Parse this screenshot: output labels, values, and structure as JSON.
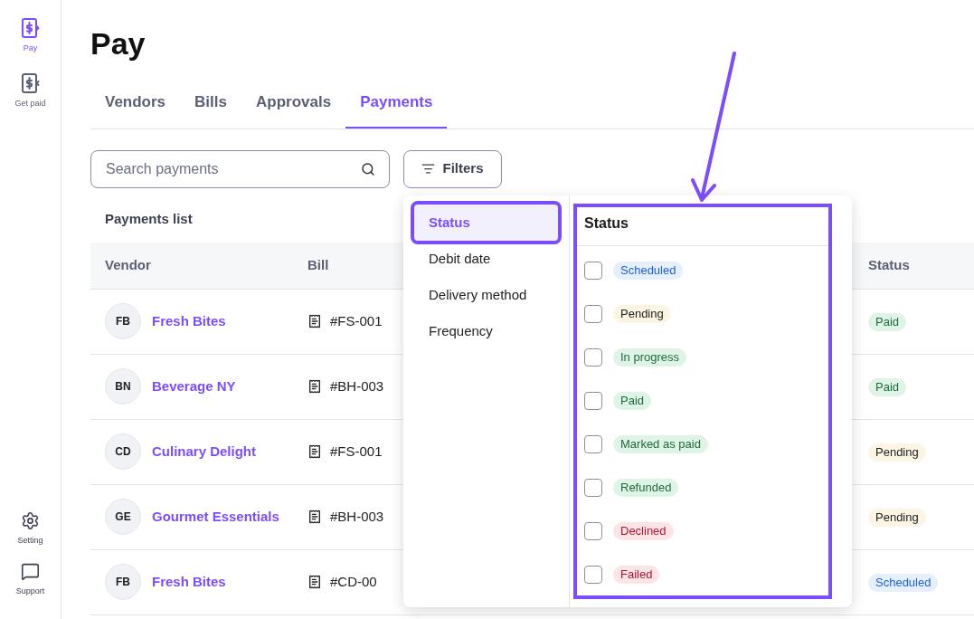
{
  "sidebar": {
    "items": [
      {
        "label": "Pay",
        "selected": true,
        "kind": "pay"
      },
      {
        "label": "Get paid",
        "selected": false,
        "kind": "getpaid"
      }
    ],
    "bottom_items": [
      {
        "label": "Setting",
        "kind": "setting"
      },
      {
        "label": "Support",
        "kind": "support"
      }
    ]
  },
  "page_title": "Pay",
  "tabs": [
    {
      "label": "Vendors",
      "selected": false
    },
    {
      "label": "Bills",
      "selected": false
    },
    {
      "label": "Approvals",
      "selected": false
    },
    {
      "label": "Payments",
      "selected": true
    }
  ],
  "search": {
    "placeholder": "Search payments"
  },
  "filters_button": "Filters",
  "list_title": "Payments list",
  "table": {
    "columns": [
      "Vendor",
      "Bill",
      "Status"
    ],
    "rows": [
      {
        "initials": "FB",
        "vendor": "Fresh Bites",
        "bill": "#FS-001",
        "status": "Paid",
        "kind": "success"
      },
      {
        "initials": "BN",
        "vendor": "Beverage NY",
        "bill": "#BH-003",
        "status": "Paid",
        "kind": "success"
      },
      {
        "initials": "CD",
        "vendor": "Culinary Delight",
        "bill": "#FS-001",
        "status": "Pending",
        "kind": "warning"
      },
      {
        "initials": "GE",
        "vendor": "Gourmet Essentials",
        "bill": "#BH-003",
        "status": "Pending",
        "kind": "warning"
      },
      {
        "initials": "FB",
        "vendor": "Fresh Bites",
        "bill": "#CD-00",
        "status": "Scheduled",
        "kind": "info"
      }
    ]
  },
  "filter_popup": {
    "menu": [
      {
        "label": "Status",
        "selected": true
      },
      {
        "label": "Debit date",
        "selected": false
      },
      {
        "label": "Delivery method",
        "selected": false
      },
      {
        "label": "Frequency",
        "selected": false
      }
    ],
    "panel_title": "Status",
    "options": [
      {
        "label": "Scheduled",
        "kind": "info",
        "checked": false
      },
      {
        "label": "Pending",
        "kind": "warning",
        "checked": false
      },
      {
        "label": "In progress",
        "kind": "success",
        "checked": false
      },
      {
        "label": "Paid",
        "kind": "success",
        "checked": false
      },
      {
        "label": "Marked as paid",
        "kind": "success",
        "checked": false
      },
      {
        "label": "Refunded",
        "kind": "success",
        "checked": false
      },
      {
        "label": "Declined",
        "kind": "error",
        "checked": false
      },
      {
        "label": "Failed",
        "kind": "error",
        "checked": false
      }
    ]
  }
}
